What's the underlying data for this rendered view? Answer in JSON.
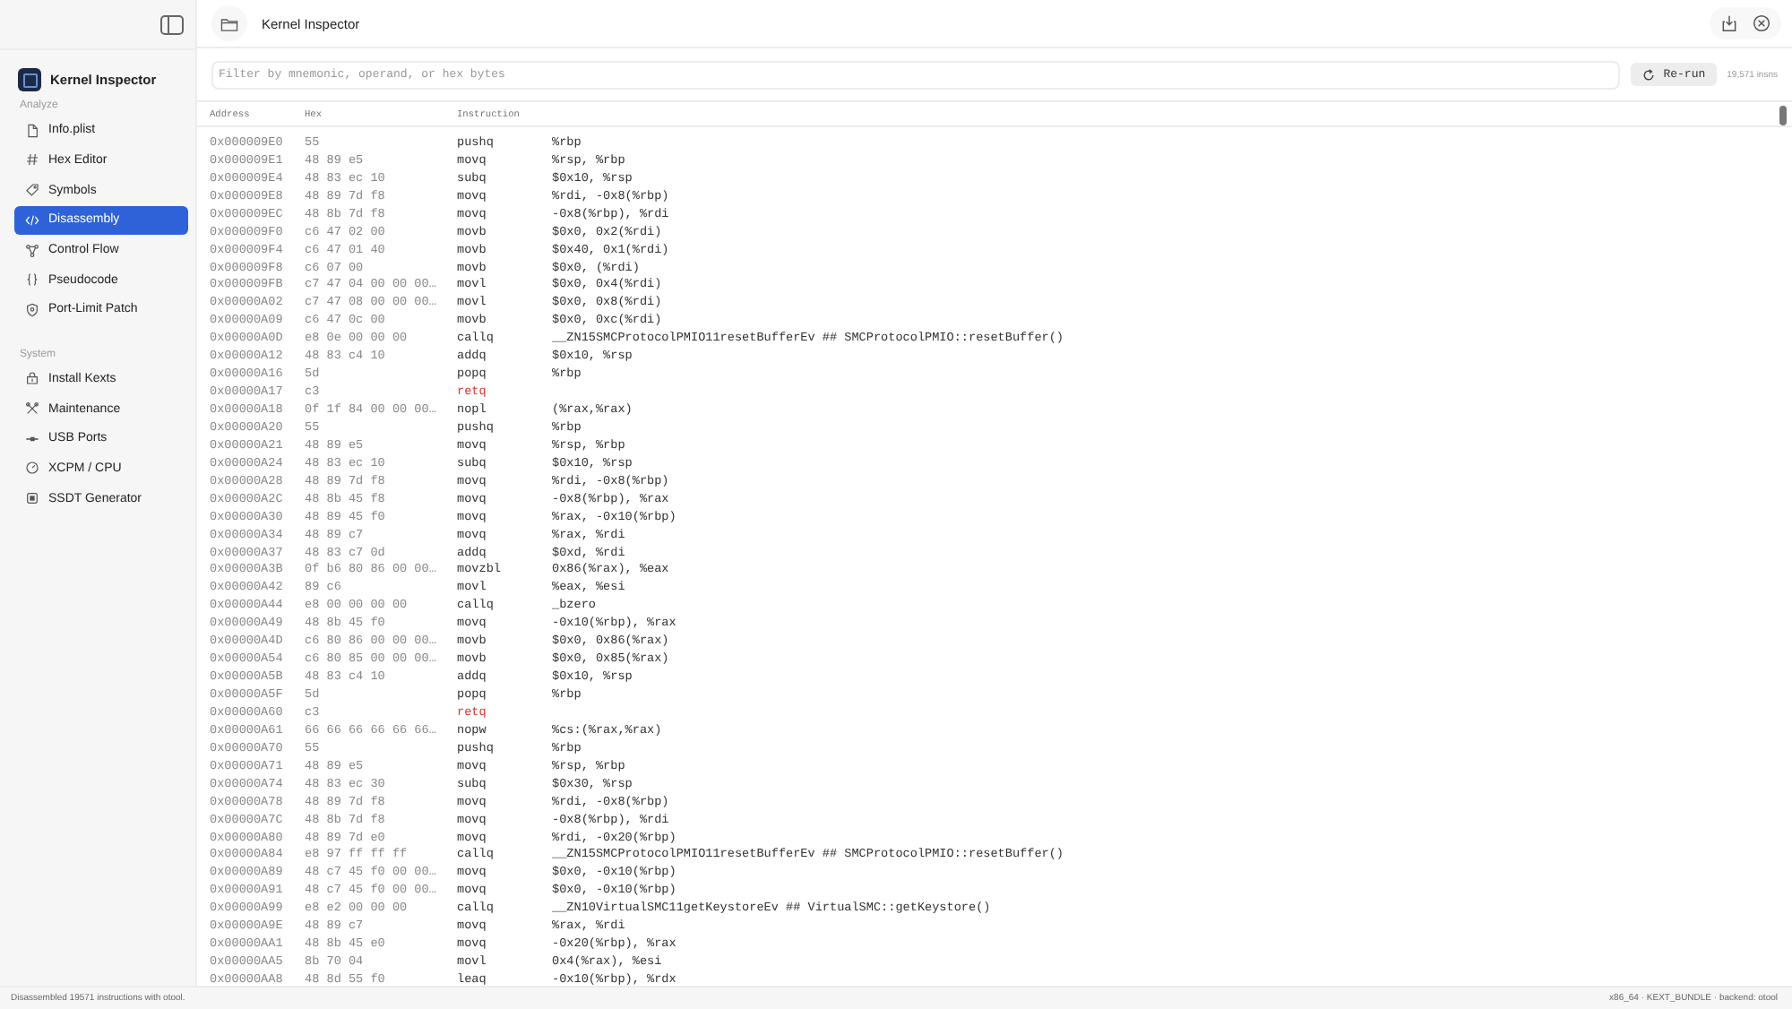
{
  "sidebar": {
    "app_title": "Kernel Inspector",
    "sections": [
      {
        "heading": "Analyze",
        "items": [
          {
            "label": "Info.plist",
            "selected": false
          },
          {
            "label": "Hex Editor",
            "selected": false
          },
          {
            "label": "Symbols",
            "selected": false
          },
          {
            "label": "Disassembly",
            "selected": true
          },
          {
            "label": "Control Flow",
            "selected": false
          },
          {
            "label": "Pseudocode",
            "selected": false
          },
          {
            "label": "Port-Limit Patch",
            "selected": false
          }
        ]
      },
      {
        "heading": "System",
        "items": [
          {
            "label": "Install Kexts",
            "selected": false
          },
          {
            "label": "Maintenance",
            "selected": false
          },
          {
            "label": "USB Ports",
            "selected": false
          },
          {
            "label": "XCPM / CPU",
            "selected": false
          },
          {
            "label": "SSDT Generator",
            "selected": false
          }
        ]
      }
    ]
  },
  "window": {
    "title": "Kernel Inspector"
  },
  "filter": {
    "placeholder": "Filter by mnemonic, operand, or hex bytes",
    "button": "Re-run",
    "count": "19,571 insns"
  },
  "table": {
    "columns": [
      "Address",
      "Hex",
      "Instruction"
    ],
    "rows": [
      {
        "address": "0x000009E0",
        "hex": "55",
        "mnemonic": "pushq",
        "operands": "%rbp",
        "kind": "op"
      },
      {
        "address": "0x000009E1",
        "hex": "48 89 e5",
        "mnemonic": "movq",
        "operands": "%rsp, %rbp",
        "kind": "op"
      },
      {
        "address": "0x000009E4",
        "hex": "48 83 ec 10",
        "mnemonic": "subq",
        "operands": "$0x10, %rsp",
        "kind": "op"
      },
      {
        "address": "0x000009E8",
        "hex": "48 89 7d f8",
        "mnemonic": "movq",
        "operands": "%rdi, -0x8(%rbp)",
        "kind": "op"
      },
      {
        "address": "0x000009EC",
        "hex": "48 8b 7d f8",
        "mnemonic": "movq",
        "operands": "-0x8(%rbp), %rdi",
        "kind": "op"
      },
      {
        "address": "0x000009F0",
        "hex": "c6 47 02 00",
        "mnemonic": "movb",
        "operands": "$0x0, 0x2(%rdi)",
        "kind": "op"
      },
      {
        "address": "0x000009F4",
        "hex": "c6 47 01 40",
        "mnemonic": "movb",
        "operands": "$0x40, 0x1(%rdi)",
        "kind": "op"
      },
      {
        "address": "0x000009F8",
        "hex": "c6 07 00",
        "mnemonic": "movb",
        "operands": "$0x0, (%rdi)",
        "kind": "op"
      },
      {
        "address": "0x000009FB",
        "hex": "c7 47 04 00 00 00…",
        "mnemonic": "movl",
        "operands": "$0x0, 0x4(%rdi)",
        "kind": "op"
      },
      {
        "address": "0x00000A02",
        "hex": "c7 47 08 00 00 00…",
        "mnemonic": "movl",
        "operands": "$0x0, 0x8(%rdi)",
        "kind": "op"
      },
      {
        "address": "0x00000A09",
        "hex": "c6 47 0c 00",
        "mnemonic": "movb",
        "operands": "$0x0, 0xc(%rdi)",
        "kind": "op"
      },
      {
        "address": "0x00000A0D",
        "hex": "e8 0e 00 00 00",
        "mnemonic": "callq",
        "operands": "__ZN15SMCProtocolPMIO11resetBufferEv ## SMCProtocolPMIO::resetBuffer()",
        "kind": "op"
      },
      {
        "address": "0x00000A12",
        "hex": "48 83 c4 10",
        "mnemonic": "addq",
        "operands": "$0x10, %rsp",
        "kind": "op"
      },
      {
        "address": "0x00000A16",
        "hex": "5d",
        "mnemonic": "popq",
        "operands": "%rbp",
        "kind": "op"
      },
      {
        "address": "0x00000A17",
        "hex": "c3",
        "mnemonic": "retq",
        "kind": "ret"
      },
      {
        "address": "0x00000A18",
        "hex": "0f 1f 84 00 00 00…",
        "mnemonic": "nopl",
        "operands": "(%rax,%rax)",
        "kind": "op"
      },
      {
        "address": "0x00000A20",
        "hex": "55",
        "mnemonic": "pushq",
        "operands": "%rbp",
        "kind": "op"
      },
      {
        "address": "0x00000A21",
        "hex": "48 89 e5",
        "mnemonic": "movq",
        "operands": "%rsp, %rbp",
        "kind": "op"
      },
      {
        "address": "0x00000A24",
        "hex": "48 83 ec 10",
        "mnemonic": "subq",
        "operands": "$0x10, %rsp",
        "kind": "op"
      },
      {
        "address": "0x00000A28",
        "hex": "48 89 7d f8",
        "mnemonic": "movq",
        "operands": "%rdi, -0x8(%rbp)",
        "kind": "op"
      },
      {
        "address": "0x00000A2C",
        "hex": "48 8b 45 f8",
        "mnemonic": "movq",
        "operands": "-0x8(%rbp), %rax",
        "kind": "op"
      },
      {
        "address": "0x00000A30",
        "hex": "48 89 45 f0",
        "mnemonic": "movq",
        "operands": "%rax, -0x10(%rbp)",
        "kind": "op"
      },
      {
        "address": "0x00000A34",
        "hex": "48 89 c7",
        "mnemonic": "movq",
        "operands": "%rax, %rdi",
        "kind": "op"
      },
      {
        "address": "0x00000A37",
        "hex": "48 83 c7 0d",
        "mnemonic": "addq",
        "operands": "$0xd, %rdi",
        "kind": "op"
      },
      {
        "address": "0x00000A3B",
        "hex": "0f b6 80 86 00 00…",
        "mnemonic": "movzbl",
        "operands": "0x86(%rax), %eax",
        "kind": "op"
      },
      {
        "address": "0x00000A42",
        "hex": "89 c6",
        "mnemonic": "movl",
        "operands": "%eax, %esi",
        "kind": "op"
      },
      {
        "address": "0x00000A44",
        "hex": "e8 00 00 00 00",
        "mnemonic": "callq",
        "operands": "_bzero",
        "kind": "op"
      },
      {
        "address": "0x00000A49",
        "hex": "48 8b 45 f0",
        "mnemonic": "movq",
        "operands": "-0x10(%rbp), %rax",
        "kind": "op"
      },
      {
        "address": "0x00000A4D",
        "hex": "c6 80 86 00 00 00…",
        "mnemonic": "movb",
        "operands": "$0x0, 0x86(%rax)",
        "kind": "op"
      },
      {
        "address": "0x00000A54",
        "hex": "c6 80 85 00 00 00…",
        "mnemonic": "movb",
        "operands": "$0x0, 0x85(%rax)",
        "kind": "op"
      },
      {
        "address": "0x00000A5B",
        "hex": "48 83 c4 10",
        "mnemonic": "addq",
        "operands": "$0x10, %rsp",
        "kind": "op"
      },
      {
        "address": "0x00000A5F",
        "hex": "5d",
        "mnemonic": "popq",
        "operands": "%rbp",
        "kind": "op"
      },
      {
        "address": "0x00000A60",
        "hex": "c3",
        "mnemonic": "retq",
        "kind": "ret"
      },
      {
        "address": "0x00000A61",
        "hex": "66 66 66 66 66 66…",
        "mnemonic": "nopw",
        "operands": "%cs:(%rax,%rax)",
        "kind": "op"
      },
      {
        "address": "0x00000A70",
        "hex": "55",
        "mnemonic": "pushq",
        "operands": "%rbp",
        "kind": "op"
      },
      {
        "address": "0x00000A71",
        "hex": "48 89 e5",
        "mnemonic": "movq",
        "operands": "%rsp, %rbp",
        "kind": "op"
      },
      {
        "address": "0x00000A74",
        "hex": "48 83 ec 30",
        "mnemonic": "subq",
        "operands": "$0x30, %rsp",
        "kind": "op"
      },
      {
        "address": "0x00000A78",
        "hex": "48 89 7d f8",
        "mnemonic": "movq",
        "operands": "%rdi, -0x8(%rbp)",
        "kind": "op"
      },
      {
        "address": "0x00000A7C",
        "hex": "48 8b 7d f8",
        "mnemonic": "movq",
        "operands": "-0x8(%rbp), %rdi",
        "kind": "op"
      },
      {
        "address": "0x00000A80",
        "hex": "48 89 7d e0",
        "mnemonic": "movq",
        "operands": "%rdi, -0x20(%rbp)",
        "kind": "op"
      },
      {
        "address": "0x00000A84",
        "hex": "e8 97 ff ff ff",
        "mnemonic": "callq",
        "operands": "__ZN15SMCProtocolPMIO11resetBufferEv ## SMCProtocolPMIO::resetBuffer()",
        "kind": "op"
      },
      {
        "address": "0x00000A89",
        "hex": "48 c7 45 f0 00 00…",
        "mnemonic": "movq",
        "operands": "$0x0, -0x10(%rbp)",
        "kind": "op"
      },
      {
        "address": "0x00000A91",
        "hex": "48 c7 45 f0 00 00…",
        "mnemonic": "movq",
        "operands": "$0x0, -0x10(%rbp)",
        "kind": "op"
      },
      {
        "address": "0x00000A99",
        "hex": "e8 e2 00 00 00",
        "mnemonic": "callq",
        "operands": "__ZN10VirtualSMC11getKeystoreEv ## VirtualSMC::getKeystore()",
        "kind": "op"
      },
      {
        "address": "0x00000A9E",
        "hex": "48 89 c7",
        "mnemonic": "movq",
        "operands": "%rax, %rdi",
        "kind": "op"
      },
      {
        "address": "0x00000AA1",
        "hex": "48 8b 45 e0",
        "mnemonic": "movq",
        "operands": "-0x20(%rbp), %rax",
        "kind": "op"
      },
      {
        "address": "0x00000AA5",
        "hex": "8b 70 04",
        "mnemonic": "movl",
        "operands": "0x4(%rax), %esi",
        "kind": "op"
      },
      {
        "address": "0x00000AA8",
        "hex": "48 8d 55 f0",
        "mnemonic": "leaq",
        "operands": "-0x10(%rbp), %rdx",
        "kind": "op"
      }
    ]
  },
  "status_bar": {
    "left": "Disassembled 19571 instructions with otool.",
    "right": "x86_64 · KEXT_BUNDLE · backend: otool"
  }
}
